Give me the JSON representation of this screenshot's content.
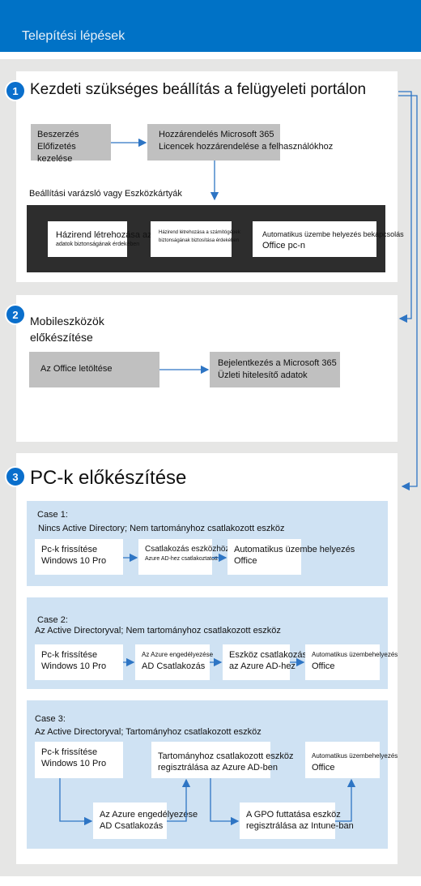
{
  "header": {
    "title": "Telepítési lépések"
  },
  "colors": {
    "header": "#0072c6",
    "arrow": "#2e75c4",
    "case_bg": "#cfe2f3",
    "gray_box": "#c0c0c0",
    "dark_box": "#2d2d2d"
  },
  "step1": {
    "badge": "1",
    "title": "Kezdeti szükséges beállítás a felügyeleti portálon",
    "box1": {
      "line1": "Beszerzés",
      "line2": "Előfizetés kezelése"
    },
    "box2": {
      "line1": "Hozzárendelés Microsoft 365",
      "line2": "Licencek hozzárendelése a felhasználókhoz"
    },
    "wizard_label": "Beállítási varázsló vagy Eszközkártyák",
    "card1": {
      "line1": "Házirend létrehozása az",
      "line2": "adatok biztonságának érdekében"
    },
    "card2": {
      "line1": "Házirend létrehozása a számítógépek",
      "line2": "biztonságának biztosítása érdekében"
    },
    "card3": {
      "line1": "Automatikus üzembe helyezés bekapcsolás",
      "line2": "Office pc-n"
    }
  },
  "step2": {
    "badge": "2",
    "title1": "Mobileszközök",
    "title2": "előkészítése",
    "box1": "Az Office letöltése",
    "box2": {
      "line1": "Bejelentkezés a Microsoft 365",
      "line2": "Üzleti hitelesítő adatok"
    }
  },
  "step3": {
    "badge": "3",
    "title": "PC-k előkészítése",
    "case1": {
      "title": "Case 1:",
      "subtitle": "Nincs Active Directory; Nem tartományhoz csatlakozott eszköz",
      "b1": {
        "line1": "Pc-k frissítése",
        "line2": "Windows 10 Pro"
      },
      "b2": {
        "line1": "Csatlakozás eszközhöz",
        "line2": "Azure AD-hez csatlakoztatott"
      },
      "b3": {
        "line1": "Automatikus üzembe helyezés",
        "line2": "Office"
      }
    },
    "case2": {
      "title": "Case 2:",
      "subtitle": "Az Active Directoryval; Nem tartományhoz csatlakozott eszköz",
      "b1": {
        "line1": "Pc-k frissítése",
        "line2": "Windows 10 Pro"
      },
      "b2": {
        "line1": "Az Azure engedélyezése",
        "line2": "AD Csatlakozás"
      },
      "b3": {
        "line1": "Eszköz csatlakozása",
        "line2": "az Azure AD-hez"
      },
      "b4": {
        "line1": "Automatikus üzembehelyezés",
        "line2": "Office"
      }
    },
    "case3": {
      "title": "Case 3:",
      "subtitle": "Az Active Directoryval; Tartományhoz csatlakozott eszköz",
      "b1": {
        "line1": "Pc-k frissítése",
        "line2": "Windows 10 Pro"
      },
      "b2": {
        "line1": "Tartományhoz csatlakozott eszköz",
        "line2": "regisztrálása az Azure AD-ben"
      },
      "b3": {
        "line1": "Automatikus üzembehelyezés",
        "line2": "Office"
      },
      "b4": {
        "line1": "Az Azure engedélyezése",
        "line2": "AD Csatlakozás"
      },
      "b5": {
        "line1": "A GPO futtatása eszköz",
        "line2": "regisztrálása az Intune-ban"
      }
    }
  }
}
